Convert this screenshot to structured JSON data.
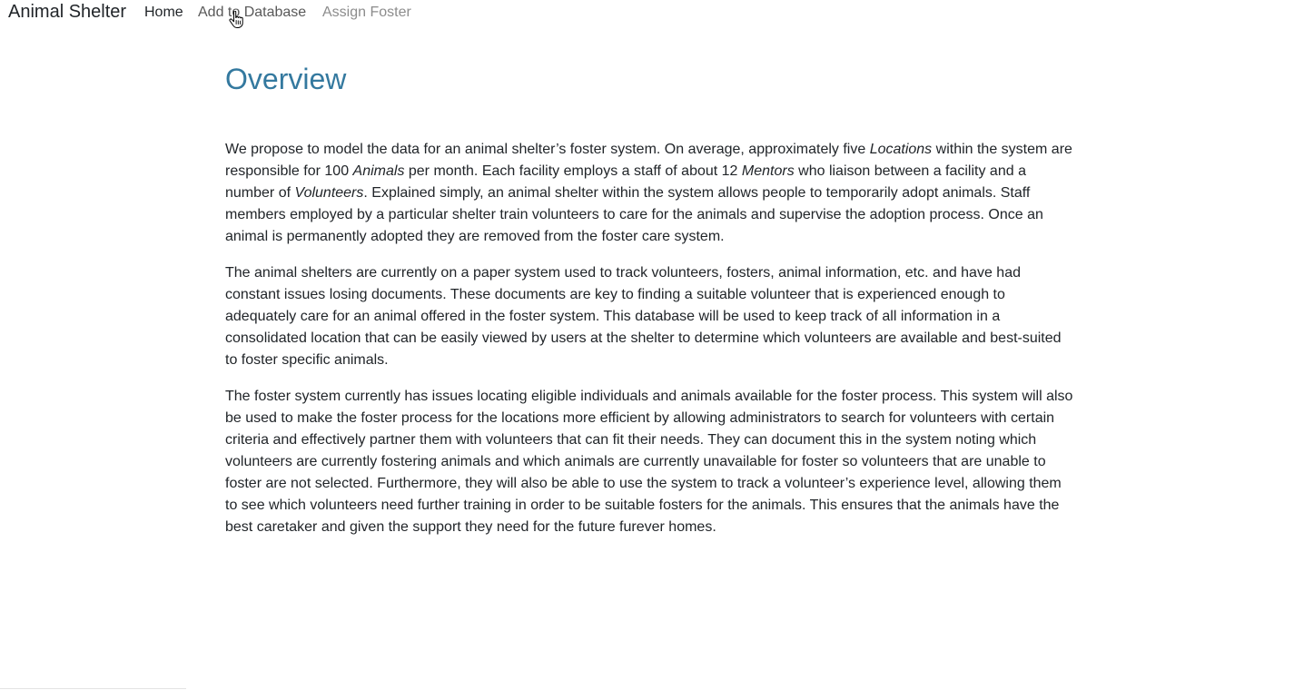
{
  "navbar": {
    "brand": "Animal Shelter",
    "links": [
      {
        "label": "Home"
      },
      {
        "label": "Add to Database"
      },
      {
        "label": "Assign Foster"
      }
    ]
  },
  "cursor": {
    "icon": "hand-pointer-icon"
  },
  "colors": {
    "title": "#34799f",
    "text": "#212529",
    "nav_muted": "#8c8c8c"
  },
  "main": {
    "title": "Overview",
    "paragraphs": [
      [
        {
          "t": "We propose to model the data for an animal shelter’s foster system. On average, approximately five "
        },
        {
          "t": "Locations",
          "em": true
        },
        {
          "t": " within the system are responsible for 100 "
        },
        {
          "t": "Animals",
          "em": true
        },
        {
          "t": " per month. Each facility employs a staff of about 12 "
        },
        {
          "t": "Mentors",
          "em": true
        },
        {
          "t": " who liaison between a facility and a number of "
        },
        {
          "t": "Volunteers",
          "em": true
        },
        {
          "t": ". Explained simply, an animal shelter within the system allows people to temporarily adopt animals. Staff members employed by a particular shelter train volunteers to care for the animals and supervise the adoption process. Once an animal is permanently adopted they are removed from the foster care system."
        }
      ],
      [
        {
          "t": "The animal shelters are currently on a paper system used to track volunteers, fosters, animal information, etc. and have had constant issues losing documents. These documents are key to finding a suitable volunteer that is experienced enough to adequately care for an animal offered in the foster system. This database will be used to keep track of all information in a consolidated location that can be easily viewed by users at the shelter to determine which volunteers are available and best-suited to foster specific animals."
        }
      ],
      [
        {
          "t": "The foster system currently has issues locating eligible individuals and animals available for the foster process. This system will also be used to make the foster process for the locations more efficient by allowing administrators to search for volunteers with certain criteria and effectively partner them with volunteers that can fit their needs. They can document this in the system noting which volunteers are currently fostering animals and which animals are currently unavailable for foster so volunteers that are unable to foster are not selected. Furthermore, they will also be able to use the system to track a volunteer’s experience level, allowing them to see which volunteers need further training in order to be suitable fosters for the animals. This ensures that the animals have the best caretaker and given the support they need for the future furever homes."
        }
      ]
    ]
  }
}
